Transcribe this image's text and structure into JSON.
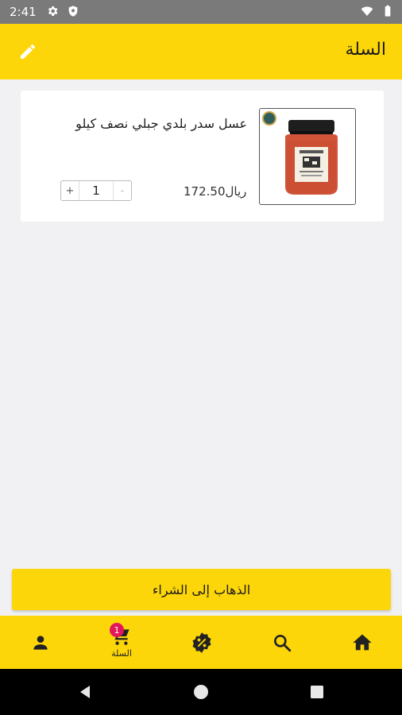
{
  "status_bar": {
    "time": "2:41",
    "icons_left": [
      "settings-icon",
      "shield-icon"
    ],
    "icons_right": [
      "wifi-icon",
      "battery-icon"
    ]
  },
  "app_bar": {
    "title": "السلة",
    "edit_icon": "pencil-icon",
    "background": "#fdd60a"
  },
  "cart": {
    "items": [
      {
        "name": "عسل سدر بلدي جبلي نصف كيلو",
        "price": "172.50ريال",
        "quantity": "1",
        "increment_label": "+",
        "decrement_label": "-"
      }
    ]
  },
  "checkout": {
    "label": "الذهاب إلى الشراء"
  },
  "bottom_nav": {
    "items": [
      {
        "icon": "person-icon",
        "label": ""
      },
      {
        "icon": "cart-icon",
        "label": "السلة",
        "badge": "1"
      },
      {
        "icon": "discount-icon",
        "label": ""
      },
      {
        "icon": "search-icon",
        "label": ""
      },
      {
        "icon": "home-icon",
        "label": ""
      }
    ],
    "badge_color": "#e2165a"
  },
  "android_nav": {
    "icons": [
      "back-icon",
      "home-circle-icon",
      "recents-icon"
    ]
  }
}
